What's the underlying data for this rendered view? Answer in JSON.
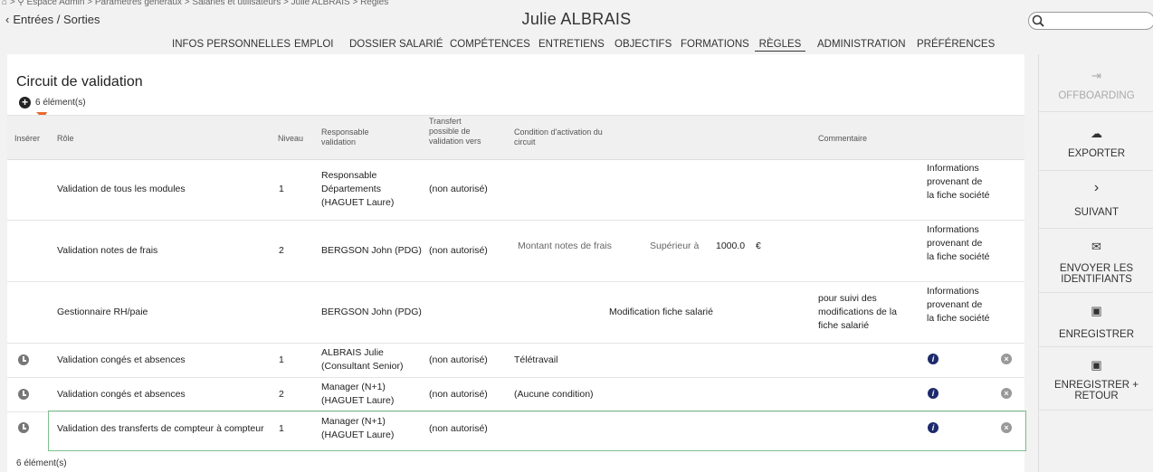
{
  "breadcrumb": "⌂ > ⚲ Espace Admin > Paramètres généraux > Salariés et utilisateurs > Julie ALBRAIS > Règles",
  "back_label": "Entrées / Sorties",
  "page_title": "Julie ALBRAIS",
  "search": {
    "placeholder": ""
  },
  "tabs": [
    {
      "label": "INFOS PERSONNELLES"
    },
    {
      "label": "EMPLOI"
    },
    {
      "label": "DOSSIER SALARIÉ"
    },
    {
      "label": "COMPÉTENCES"
    },
    {
      "label": "ENTRETIENS"
    },
    {
      "label": "OBJECTIFS"
    },
    {
      "label": "FORMATIONS"
    },
    {
      "label": "RÈGLES",
      "active": true
    },
    {
      "label": "ADMINISTRATION"
    },
    {
      "label": "PRÉFÉRENCES"
    }
  ],
  "section": {
    "title": "Circuit de validation",
    "count_top": "6 élément(s)",
    "count_bottom": "6 élément(s)"
  },
  "table": {
    "headers": {
      "inserer": "Insérer",
      "role": "Rôle",
      "niveau": "Niveau",
      "responsable": "Responsable validation",
      "transfert": "Transfert possible de validation vers",
      "condition": "Condition d'activation du circuit",
      "commentaire": "Commentaire"
    },
    "rows": [
      {
        "role": "Validation de tous les modules",
        "niveau": "1",
        "responsable": "Responsable Départements (HAGUET Laure)",
        "transfert": "(non autorisé)",
        "condition": "",
        "commentaire": "",
        "info": "Informations provenant de la fiche société"
      },
      {
        "role": "Validation notes de frais",
        "niveau": "2",
        "responsable": "BERGSON John (PDG)",
        "transfert": "(non autorisé)",
        "cond_field": "Montant notes de frais",
        "cond_op": "Supérieur à",
        "cond_value": "1000.0",
        "cond_unit": "€",
        "commentaire": "",
        "info": "Informations provenant de la fiche société"
      },
      {
        "role": "Gestionnaire RH/paie",
        "niveau": "",
        "responsable": "BERGSON John (PDG)",
        "transfert": "",
        "condition": "Modification fiche salarié",
        "commentaire": "pour suivi des modifications de la fiche salarié",
        "info": "Informations provenant de la fiche société"
      },
      {
        "role": "Validation congés et absences",
        "niveau": "1",
        "responsable": "ALBRAIS Julie (Consultant Senior)",
        "transfert": "(non autorisé)",
        "condition": "Télétravail",
        "commentaire": ""
      },
      {
        "role": "Validation congés et absences",
        "niveau": "2",
        "responsable": "Manager (N+1) (HAGUET Laure)",
        "transfert": "(non autorisé)",
        "condition": "(Aucune condition)",
        "commentaire": ""
      },
      {
        "role": "Validation des transferts de compteur à compteur",
        "niveau": "1",
        "responsable": "Manager (N+1) (HAGUET Laure)",
        "transfert": "(non autorisé)",
        "condition": "",
        "commentaire": ""
      }
    ]
  },
  "actions": [
    {
      "label": "OFFBOARDING",
      "icon": "exit-icon",
      "glyph": "⇥",
      "disabled": true
    },
    {
      "label": "EXPORTER",
      "icon": "cloud-download-icon",
      "glyph": "☁"
    },
    {
      "label": "SUIVANT",
      "icon": "chevron-right-icon",
      "glyph": "›"
    },
    {
      "label": "ENVOYER LES IDENTIFIANTS",
      "icon": "envelope-icon",
      "glyph": "✉"
    },
    {
      "label": "ENREGISTRER",
      "icon": "floppy-icon",
      "glyph": "▣"
    },
    {
      "label": "ENREGISTRER + RETOUR",
      "icon": "floppy-icon",
      "glyph": "▣"
    }
  ],
  "colors": {
    "highlight": "#7dbf8e",
    "arrow": "#e8692c",
    "info_icon": "#1c2a6b"
  }
}
